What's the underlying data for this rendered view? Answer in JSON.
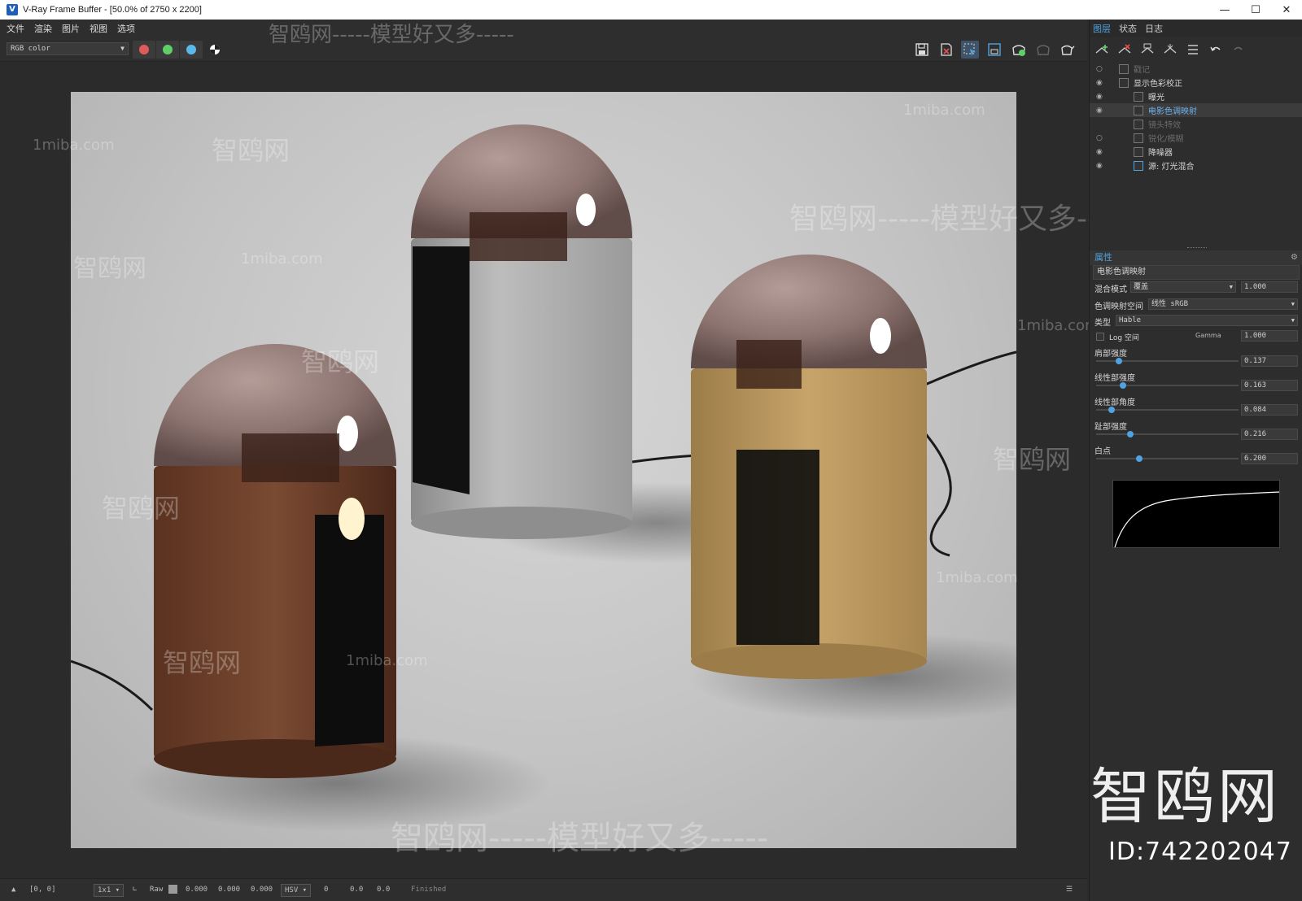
{
  "window": {
    "title": "V-Ray Frame Buffer - [50.0% of 2750 x 2200]",
    "app_icon_glyph": "V",
    "controls": [
      "minimize-icon",
      "maximize-icon",
      "close-icon"
    ]
  },
  "menu": {
    "items": [
      "文件",
      "渲染",
      "图片",
      "视图",
      "选项"
    ]
  },
  "toolbar": {
    "channel": "RGB color",
    "colors": {
      "red": "#e05a5a",
      "green": "#5fcf6a",
      "blue": "#5ab8ea"
    },
    "icons": [
      "save-icon",
      "clear-icon",
      "region-select-icon",
      "region-icon",
      "render-icon",
      "render-disabled-icon",
      "teapot-icon"
    ]
  },
  "status": {
    "coords": "[0, 0]",
    "sample": "1x1",
    "raw_label": "Raw",
    "raw_values": [
      "0.000",
      "0.000",
      "0.000"
    ],
    "color_mode": "HSV",
    "hsv_values": [
      "0",
      "0.0",
      "0.0"
    ],
    "state": "Finished"
  },
  "panel": {
    "tabs": [
      "图层",
      "状态",
      "日志"
    ],
    "active_tab": 0,
    "layers": [
      {
        "name": "戳记",
        "visible": false
      },
      {
        "name": "显示色彩校正",
        "visible": true
      },
      {
        "name": "曝光",
        "visible": true
      },
      {
        "name": "电影色调映射",
        "visible": true,
        "selected": true
      },
      {
        "name": "镜头特效",
        "visible": false
      },
      {
        "name": "锐化/模糊",
        "visible": false
      },
      {
        "name": "降噪器",
        "visible": true
      },
      {
        "name": "源: 灯光混合",
        "visible": true
      }
    ],
    "properties": {
      "header": "属性",
      "layer_name": "电影色调映射",
      "blend_mode_label": "混合模式",
      "blend_mode_value": "覆盖",
      "blend_amount": "1.000",
      "tonemap_space_label": "色调映射空间",
      "tonemap_space_value": "线性 sRGB",
      "type_label": "类型",
      "type_value": "Hable",
      "log_space_label": "Log 空间",
      "gamma_label": "Gamma",
      "gamma_value": "1.000",
      "sliders": [
        {
          "label": "肩部强度",
          "value": "0.137",
          "fraction": 0.137
        },
        {
          "label": "线性部强度",
          "value": "0.163",
          "fraction": 0.163
        },
        {
          "label": "线性部角度",
          "value": "0.084",
          "fraction": 0.084
        },
        {
          "label": "趾部强度",
          "value": "0.216",
          "fraction": 0.216
        },
        {
          "label": "白点",
          "value": "6.200",
          "fraction": 0.28
        }
      ]
    }
  },
  "watermarks": {
    "site": "1miba.com",
    "brand": "智鸥网",
    "slogan": "智鸥网-----模型好又多-----",
    "big": "智鸥网",
    "id": "ID:742202047"
  }
}
